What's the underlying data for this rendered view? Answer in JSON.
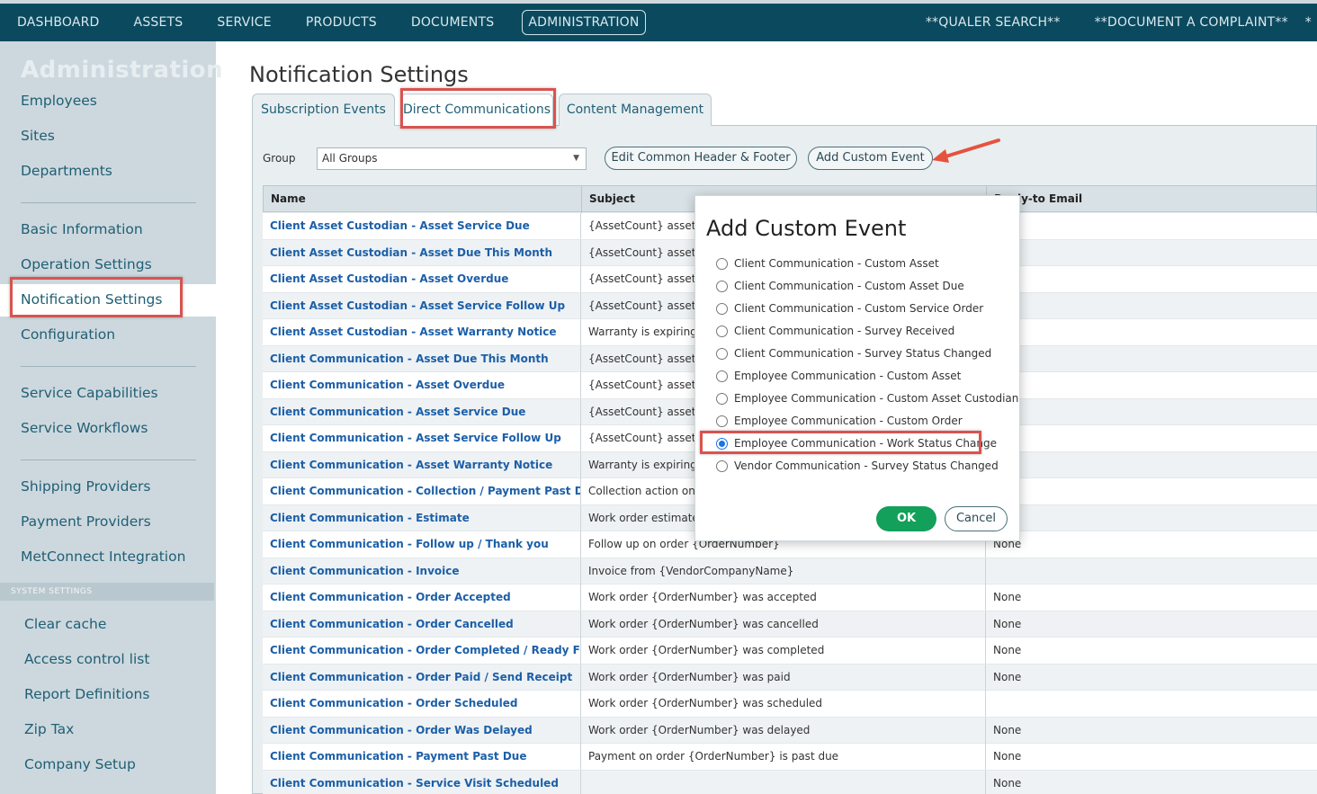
{
  "topnav": {
    "items": [
      "DASHBOARD",
      "ASSETS",
      "SERVICE",
      "PRODUCTS",
      "DOCUMENTS",
      "ADMINISTRATION"
    ],
    "active": "ADMINISTRATION",
    "right_items": [
      "**QUALER SEARCH**",
      "**DOCUMENT A COMPLAINT**",
      "*"
    ]
  },
  "sidebar": {
    "title": "Administration",
    "groups": [
      [
        "Employees",
        "Sites",
        "Departments"
      ],
      [
        "Basic Information",
        "Operation Settings",
        "Notification Settings",
        "Configuration"
      ],
      [
        "Service Capabilities",
        "Service Workflows"
      ],
      [
        "Shipping Providers",
        "Payment Providers",
        "MetConnect Integration"
      ]
    ],
    "active_item": "Notification Settings",
    "system_header": "SYSTEM SETTINGS",
    "system_items": [
      "Clear cache",
      "Access control list",
      "Report Definitions",
      "Zip Tax",
      "Company Setup"
    ]
  },
  "page": {
    "title": "Notification Settings",
    "tabs": [
      "Subscription Events",
      "Direct Communications",
      "Content Management"
    ],
    "active_tab": "Direct Communications"
  },
  "toolbar": {
    "group_label": "Group",
    "group_value": "All Groups",
    "edit_header_footer_label": "Edit Common Header & Footer",
    "add_custom_event_label": "Add Custom Event"
  },
  "table": {
    "columns": [
      "Name",
      "Subject",
      "Reply-to Email"
    ],
    "rows": [
      {
        "name": "Client Asset Custodian - Asset Service Due",
        "subject": "{AssetCount} assets ar",
        "reply": ""
      },
      {
        "name": "Client Asset Custodian - Asset Due This Month",
        "subject": "{AssetCount} assets ar",
        "reply": ""
      },
      {
        "name": "Client Asset Custodian - Asset Overdue",
        "subject": "{AssetCount} assets ar",
        "reply": ""
      },
      {
        "name": "Client Asset Custodian - Asset Service Follow Up",
        "subject": "{AssetCount} asset(s) s",
        "reply": ""
      },
      {
        "name": "Client Asset Custodian - Asset Warranty Notice",
        "subject": "Warranty is expiring fo",
        "reply": ""
      },
      {
        "name": "Client Communication - Asset Due This Month",
        "subject": "{AssetCount} assets ar",
        "reply": ""
      },
      {
        "name": "Client Communication - Asset Overdue",
        "subject": "{AssetCount} assets ar",
        "reply": ""
      },
      {
        "name": "Client Communication - Asset Service Due",
        "subject": "{AssetCount} assets ar",
        "reply": ""
      },
      {
        "name": "Client Communication - Asset Service Follow Up",
        "subject": "{AssetCount} asset(s) s",
        "reply": ""
      },
      {
        "name": "Client Communication - Asset Warranty Notice",
        "subject": "Warranty is expiring fo",
        "reply": ""
      },
      {
        "name": "Client Communication - Collection / Payment Past Due",
        "subject": "Collection action on o",
        "reply": ""
      },
      {
        "name": "Client Communication - Estimate",
        "subject": "Work order estimate f",
        "reply": ""
      },
      {
        "name": "Client Communication - Follow up / Thank you",
        "subject": "Follow up on order {OrderNumber}",
        "reply": "None"
      },
      {
        "name": "Client Communication - Invoice",
        "subject": "Invoice from {VendorCompanyName}",
        "reply": ""
      },
      {
        "name": "Client Communication - Order Accepted",
        "subject": "Work order {OrderNumber} was accepted",
        "reply": "None"
      },
      {
        "name": "Client Communication - Order Cancelled",
        "subject": "Work order {OrderNumber} was cancelled",
        "reply": "None"
      },
      {
        "name": "Client Communication - Order Completed / Ready For Sign off",
        "subject": "Work order {OrderNumber} was completed",
        "reply": "None"
      },
      {
        "name": "Client Communication - Order Paid / Send Receipt",
        "subject": "Work order {OrderNumber} was paid",
        "reply": "None"
      },
      {
        "name": "Client Communication - Order Scheduled",
        "subject": "Work order {OrderNumber} was scheduled",
        "reply": ""
      },
      {
        "name": "Client Communication - Order Was Delayed",
        "subject": "Work order {OrderNumber} was delayed",
        "reply": "None"
      },
      {
        "name": "Client Communication - Payment Past Due",
        "subject": "Payment on order {OrderNumber} is past due",
        "reply": "None"
      },
      {
        "name": "Client Communication - Service Visit Scheduled",
        "subject": "",
        "reply": "None"
      }
    ]
  },
  "modal": {
    "title": "Add Custom Event",
    "options": [
      "Client Communication - Custom Asset",
      "Client Communication - Custom Asset Due",
      "Client Communication - Custom Service Order",
      "Client Communication - Survey Received",
      "Client Communication - Survey Status Changed",
      "Employee Communication - Custom Asset",
      "Employee Communication - Custom Asset Custodian",
      "Employee Communication - Custom Order",
      "Employee Communication - Work Status Change",
      "Vendor Communication - Survey Status Changed"
    ],
    "selected": "Employee Communication - Work Status Change",
    "ok_label": "OK",
    "cancel_label": "Cancel"
  },
  "colors": {
    "nav_bg": "#0b4a5e",
    "sidebar_bg": "#cdd8de",
    "link_blue": "#1c5fa8",
    "ok_green": "#13a05a",
    "highlight_red": "#d9534f"
  }
}
